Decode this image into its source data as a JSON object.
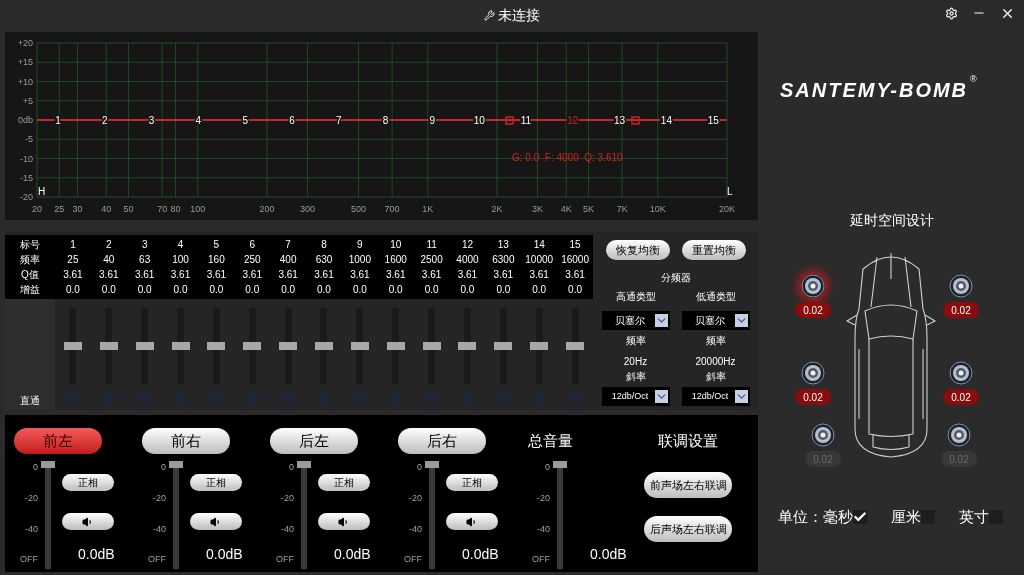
{
  "title_bar": {
    "title": "未连接"
  },
  "eq_graph": {
    "y_labels": [
      "+20",
      "+15",
      "+10",
      "+5",
      "0db",
      "-5",
      "-10",
      "-15",
      "-20"
    ],
    "x_labels": [
      "20",
      "25",
      "30",
      "40",
      "50",
      "70",
      "80",
      "100",
      "200",
      "300",
      "500",
      "700",
      "1K",
      "2K",
      "3K",
      "4K",
      "5K",
      "7K",
      "10K",
      "20K"
    ],
    "bands": [
      {
        "label": "1",
        "selected": false
      },
      {
        "label": "2",
        "selected": false
      },
      {
        "label": "3",
        "selected": false
      },
      {
        "label": "4",
        "selected": false
      },
      {
        "label": "5",
        "selected": false
      },
      {
        "label": "6",
        "selected": false
      },
      {
        "label": "7",
        "selected": false
      },
      {
        "label": "8",
        "selected": false
      },
      {
        "label": "9",
        "selected": false
      },
      {
        "label": "10",
        "selected": false
      },
      {
        "label": "11",
        "selected": false
      },
      {
        "label": "12",
        "selected": true
      },
      {
        "label": "13",
        "selected": false
      },
      {
        "label": "14",
        "selected": false
      },
      {
        "label": "15",
        "selected": false
      }
    ],
    "readout": "G: 0.0  F: 4000  Q: 3.610",
    "high_label": "H",
    "low_label": "L"
  },
  "eq_table": {
    "row_labels": [
      "标号",
      "频率",
      "Q值",
      "增益"
    ],
    "bypass_label": "直通",
    "bands": [
      {
        "number": "1",
        "frequency": "25",
        "q": "3.61",
        "gain": "0.0",
        "level": 0.5
      },
      {
        "number": "2",
        "frequency": "40",
        "q": "3.61",
        "gain": "0.0",
        "level": 0.5
      },
      {
        "number": "3",
        "frequency": "63",
        "q": "3.61",
        "gain": "0.0",
        "level": 0.5
      },
      {
        "number": "4",
        "frequency": "100",
        "q": "3.61",
        "gain": "0.0",
        "level": 0.5
      },
      {
        "number": "5",
        "frequency": "160",
        "q": "3.61",
        "gain": "0.0",
        "level": 0.5
      },
      {
        "number": "6",
        "frequency": "250",
        "q": "3.61",
        "gain": "0.0",
        "level": 0.5
      },
      {
        "number": "7",
        "frequency": "400",
        "q": "3.61",
        "gain": "0.0",
        "level": 0.5
      },
      {
        "number": "8",
        "frequency": "630",
        "q": "3.61",
        "gain": "0.0",
        "level": 0.5
      },
      {
        "number": "9",
        "frequency": "1000",
        "q": "3.61",
        "gain": "0.0",
        "level": 0.5
      },
      {
        "number": "10",
        "frequency": "1600",
        "q": "3.61",
        "gain": "0.0",
        "level": 0.5
      },
      {
        "number": "11",
        "frequency": "2500",
        "q": "3.61",
        "gain": "0.0",
        "level": 0.5
      },
      {
        "number": "12",
        "frequency": "4000",
        "q": "3.61",
        "gain": "0.0",
        "level": 0.5
      },
      {
        "number": "13",
        "frequency": "6300",
        "q": "3.61",
        "gain": "0.0",
        "level": 0.5
      },
      {
        "number": "14",
        "frequency": "10000",
        "q": "3.61",
        "gain": "0.0",
        "level": 0.5
      },
      {
        "number": "15",
        "frequency": "16000",
        "q": "3.61",
        "gain": "0.0",
        "level": 0.5
      }
    ]
  },
  "eq_actions": [
    "恢复均衡",
    "重置均衡"
  ],
  "crossover": {
    "title": "分频器",
    "filters": [
      {
        "type_label": "高通类型",
        "type": "贝塞尔",
        "frequency_label": "频率",
        "frequency": "20Hz",
        "slope_label": "斜率",
        "slope": "12db/Oct"
      },
      {
        "type_label": "低通类型",
        "type": "贝塞尔",
        "frequency_label": "频率",
        "frequency": "20000Hz",
        "slope_label": "斜率",
        "slope": "12db/Oct"
      }
    ]
  },
  "channels": [
    {
      "name": "前左",
      "selected": true,
      "scale": [
        "0",
        "-20",
        "-40",
        "OFF"
      ],
      "level": 1,
      "phase": "正相",
      "gain": "0.0dB"
    },
    {
      "name": "前右",
      "selected": false,
      "scale": [
        "0",
        "-20",
        "-40",
        "OFF"
      ],
      "level": 1,
      "phase": "正相",
      "gain": "0.0dB"
    },
    {
      "name": "后左",
      "selected": false,
      "scale": [
        "0",
        "-20",
        "-40",
        "OFF"
      ],
      "level": 1,
      "phase": "正相",
      "gain": "0.0dB"
    },
    {
      "name": "后右",
      "selected": false,
      "scale": [
        "0",
        "-20",
        "-40",
        "OFF"
      ],
      "level": 1,
      "phase": "正相",
      "gain": "0.0dB"
    }
  ],
  "master": {
    "label": "总音量",
    "scale": [
      "0",
      "-20",
      "-40",
      "OFF"
    ],
    "level": 1,
    "gain": "0.0dB"
  },
  "link": {
    "title": "联调设置",
    "buttons": [
      "前声场左右联调",
      "后声场左右联调"
    ]
  },
  "brand": {
    "logo": "SANTEMY-BOMB",
    "mark": "®"
  },
  "delay": {
    "title": "延时空间设计",
    "speakers": [
      {
        "value": "0.02",
        "selected": true,
        "enabled": true
      },
      {
        "value": "0.02",
        "selected": false,
        "enabled": true
      },
      {
        "value": "0.02",
        "selected": false,
        "enabled": true
      },
      {
        "value": "0.02",
        "selected": false,
        "enabled": true
      },
      {
        "value": "0.02",
        "selected": false,
        "enabled": false
      },
      {
        "value": "0.02",
        "selected": false,
        "enabled": false
      }
    ]
  },
  "units": {
    "label": "单位：",
    "options": [
      {
        "label": "毫秒",
        "checked": true
      },
      {
        "label": "厘米",
        "checked": false
      },
      {
        "label": "英寸",
        "checked": false
      }
    ]
  }
}
